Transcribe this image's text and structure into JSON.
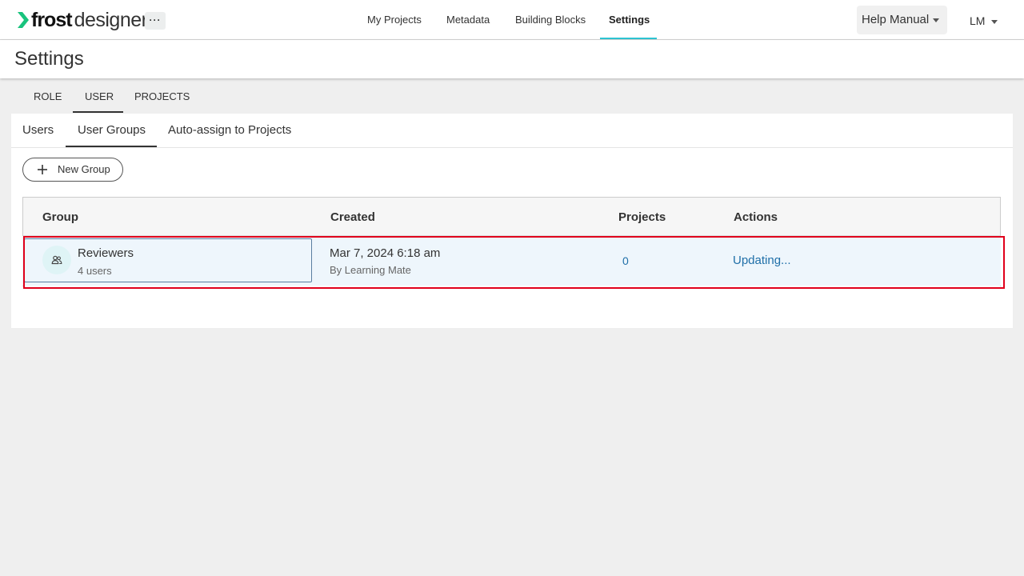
{
  "header": {
    "logo_bold": "frost",
    "logo_light": "designer",
    "more_label": "···",
    "nav": [
      "My Projects",
      "Metadata",
      "Building Blocks",
      "Settings"
    ],
    "active_nav": "Settings",
    "help_label": "Help Manual",
    "user_initials": "LM"
  },
  "page": {
    "title": "Settings"
  },
  "primary_tabs": [
    "ROLE",
    "USER",
    "PROJECTS"
  ],
  "active_primary_tab": "USER",
  "secondary_tabs": [
    "Users",
    "User Groups",
    "Auto-assign to Projects"
  ],
  "active_secondary_tab": "User Groups",
  "toolbar": {
    "new_group_label": "New Group"
  },
  "table": {
    "columns": [
      "Group",
      "Created",
      "Projects",
      "Actions"
    ],
    "rows": [
      {
        "group_name": "Reviewers",
        "group_users": "4 users",
        "created_date": "Mar 7, 2024 6:18 am",
        "created_by": "By Learning Mate",
        "projects": "0",
        "actions": "Updating..."
      }
    ]
  },
  "colors": {
    "accent": "#2ec5d3",
    "link": "#1f6fa8",
    "highlight": "#e0001b",
    "logo_green": "#19c37d"
  },
  "icons": {
    "more": "more-horizontal-icon",
    "help_caret": "caret-down-icon",
    "user_caret": "caret-down-icon",
    "new_group": "plus-icon",
    "group_avatar": "users-group-icon"
  }
}
